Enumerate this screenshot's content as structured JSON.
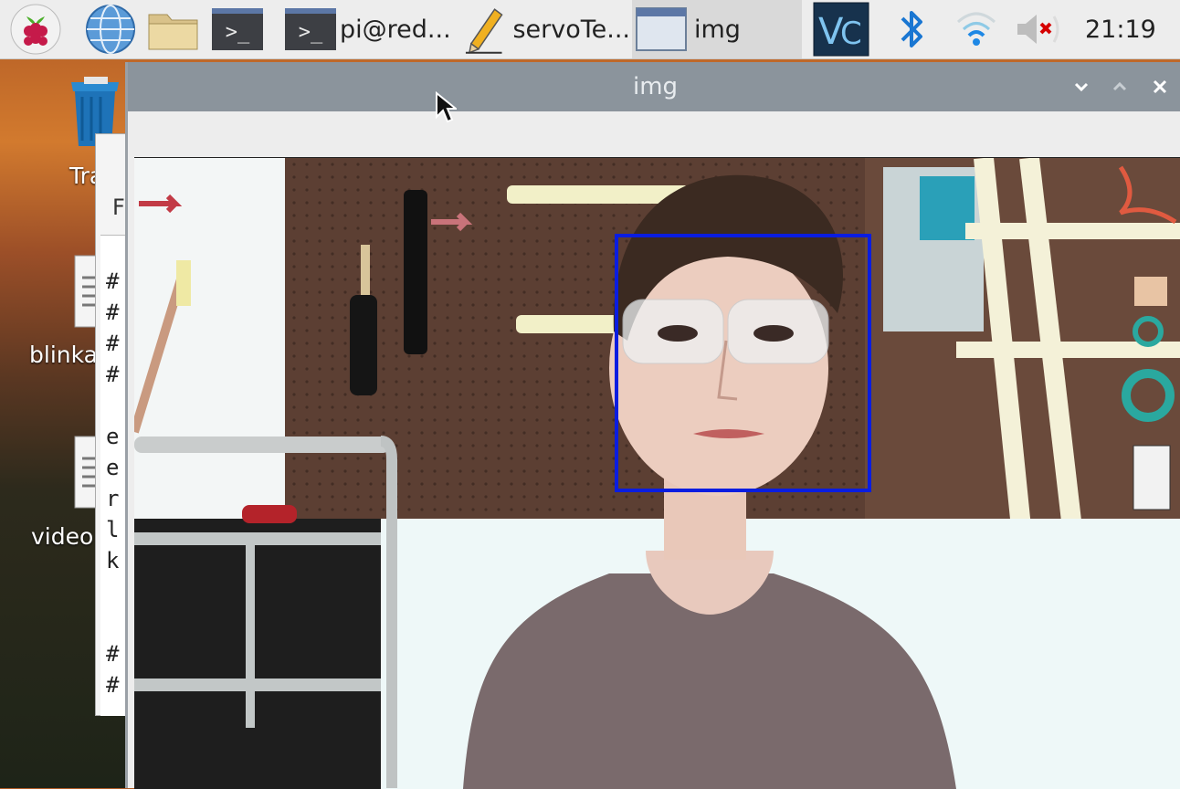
{
  "taskbar": {
    "raspberry_menu_icon": "raspberry-icon",
    "browser_icon": "globe-icon",
    "files_icon": "folder-icon",
    "terminal_icon": "terminal-icon",
    "terminal_glyph": ">_",
    "windows": [
      {
        "label": "pi@red...",
        "icon": "terminal-icon"
      },
      {
        "label": "servoTe...",
        "icon": "pencil-icon"
      },
      {
        "label": "img",
        "icon": "window-icon",
        "active": true
      }
    ],
    "tray": {
      "vnc_icon": "vnc-icon",
      "bluetooth_icon": "bluetooth-icon",
      "wifi_icon": "wifi-icon",
      "volume_icon": "volume-muted-icon"
    },
    "clock": "21:19"
  },
  "desktop": {
    "icons": [
      {
        "label": "Tra",
        "icon": "trash-icon"
      },
      {
        "label": "blinka",
        "icon": "document-icon"
      },
      {
        "label": "video",
        "icon": "document-icon"
      }
    ]
  },
  "editor_window": {
    "menu_label": "F",
    "code_lines": [
      "#",
      "#",
      "#",
      "#",
      "",
      "e",
      "e",
      "r",
      "l",
      "k",
      "",
      "",
      "#",
      "#"
    ]
  },
  "img_window": {
    "title": "img",
    "controls": [
      "minimize-icon",
      "maximize-icon",
      "close-icon"
    ]
  },
  "colors": {
    "taskbar_bg": "#ededed",
    "titlebar_bg": "#8b949c",
    "face_box": "#0a1de0"
  }
}
